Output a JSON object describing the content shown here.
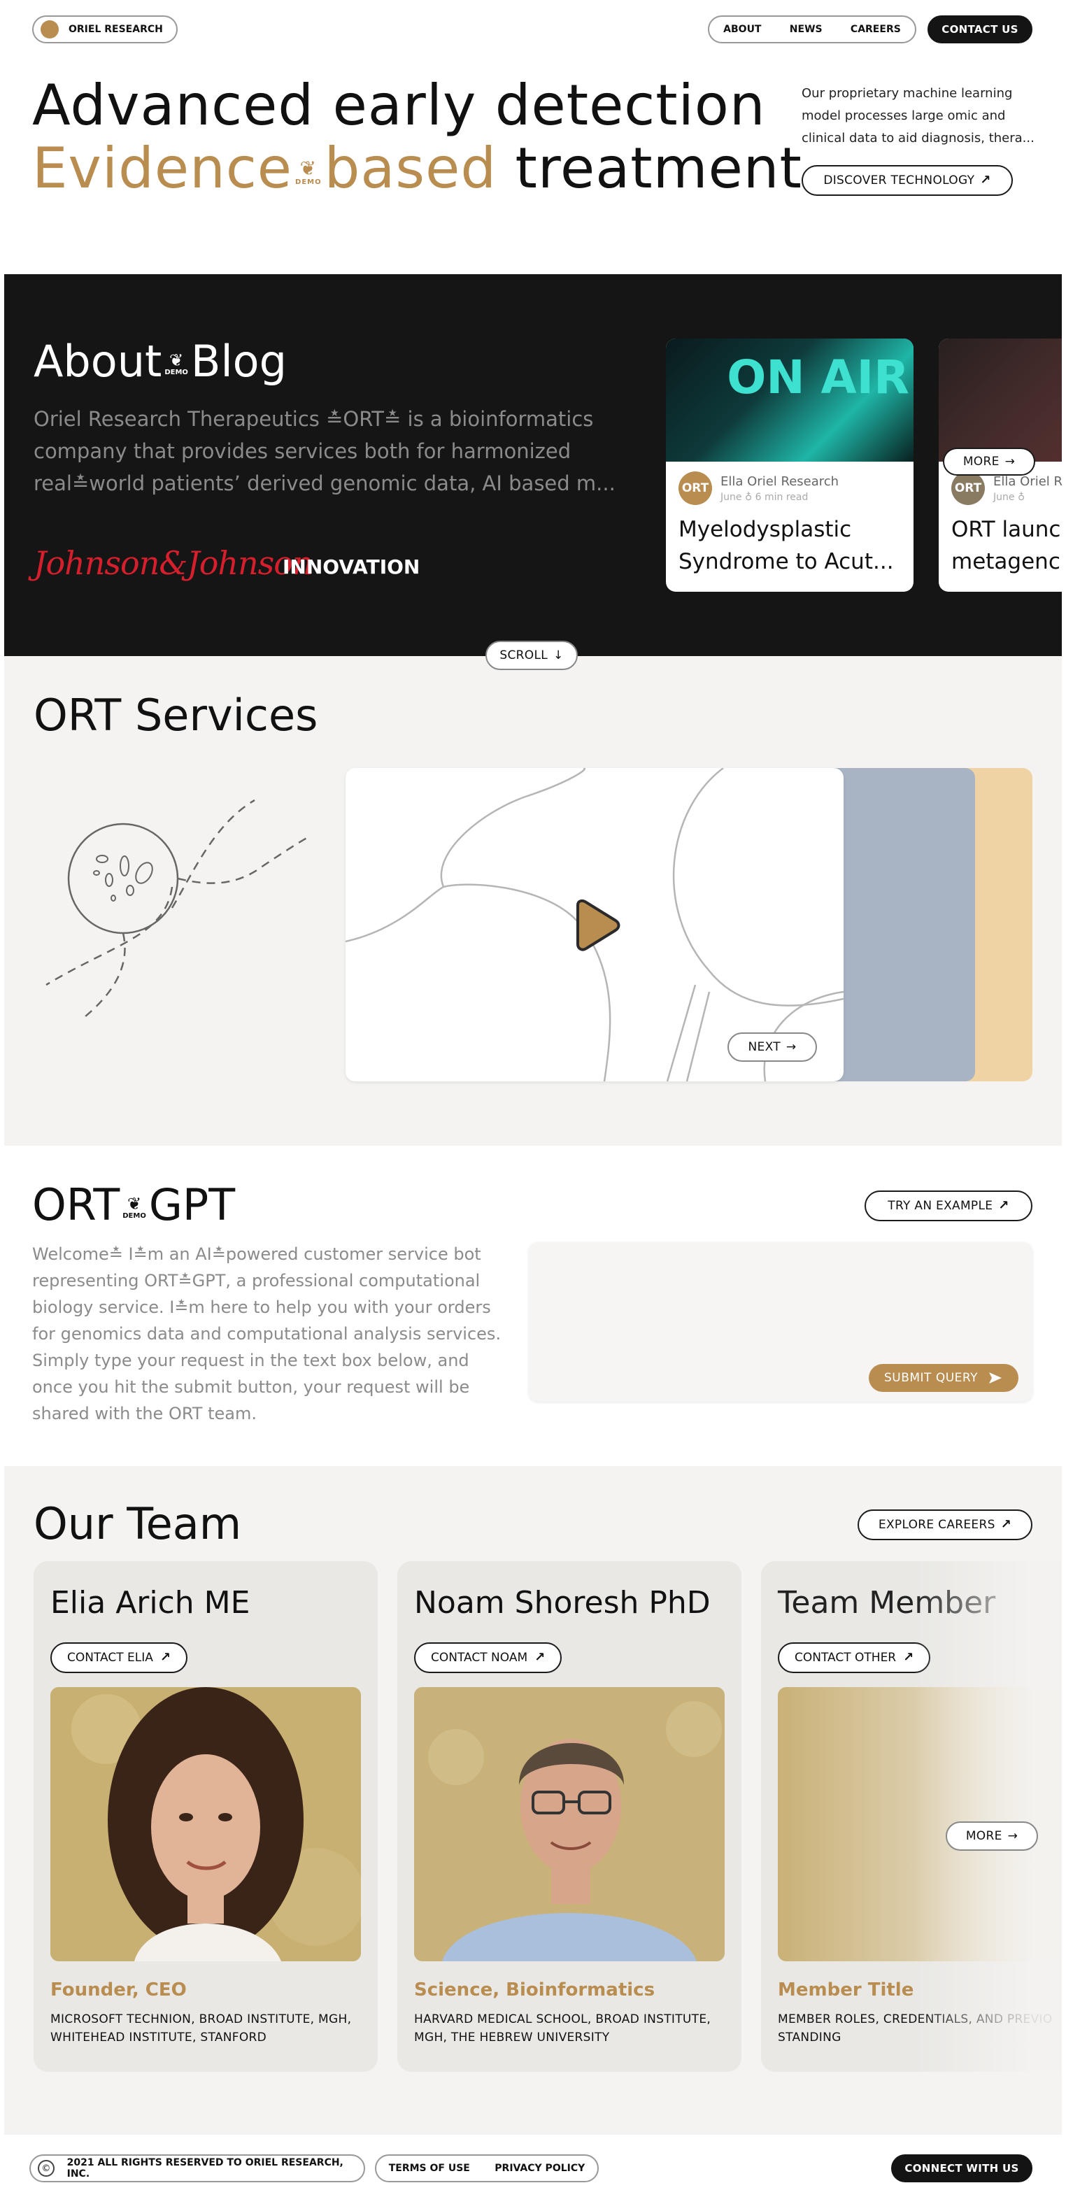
{
  "nav": {
    "brand": "ORIEL RESEARCH",
    "links": [
      "ABOUT",
      "NEWS",
      "CAREERS"
    ],
    "contact": "CONTACT US"
  },
  "hero": {
    "line1": "Advanced early detection",
    "line2_a": "Evidence",
    "line2_b": "based",
    "line2_c": "treatment.",
    "demo_mark": "DEMO",
    "description": "Our proprietary machine learning model processes large omic and clinical data to aid diagnosis, thera...",
    "cta": "DISCOVER TECHNOLOGY"
  },
  "about": {
    "title_a": "About",
    "title_b": "Blog",
    "demo_mark": "DEMO",
    "body": "Oriel Research Therapeutics ≛ORT≛ is a bioinformatics company that provides services both for harmonized real≛world patients’ derived genomic data, AI based m...",
    "partner_logo": "Johnson&Johnson",
    "partner_suffix": "INNOVATION"
  },
  "blog": {
    "cards": [
      {
        "image_text": "ON AIR",
        "avatar": "ORT",
        "author": "Ella Oriel Research",
        "date": "June ♁ 6 min read",
        "title": "Myelodysplastic Syndrome to Acut..."
      },
      {
        "image_text": "",
        "avatar": "ORT",
        "author": "Ella Oriel R",
        "date": "June ♁",
        "title": "ORT launc metagenc"
      }
    ],
    "more": "MORE",
    "scroll": "SCROLL"
  },
  "services": {
    "title": "ORT Services",
    "next": "NEXT"
  },
  "gpt": {
    "title_a": "ORT",
    "title_b": "GPT",
    "demo_mark": "DEMO",
    "try": "TRY AN EXAMPLE",
    "description": "Welcome≛ I≛m an AI≛powered customer service bot representing ORT≛GPT, a professional computational biology service. I≛m here to help you with your orders for genomics data and computational analysis services. Simply type your request in the text box below, and once you hit the submit button, your request will be shared with the ORT team.",
    "submit": "SUBMIT QUERY"
  },
  "team": {
    "title": "Our Team",
    "explore": "EXPLORE CAREERS",
    "more": "MORE",
    "members": [
      {
        "name": "Elia Arich ME",
        "contact": "CONTACT ELIA",
        "role": "Founder, CEO",
        "credentials": "MICROSOFT TECHNION, BROAD INSTITUTE, MGH, WHITEHEAD INSTITUTE, STANFORD"
      },
      {
        "name": "Noam Shoresh PhD",
        "contact": "CONTACT NOAM",
        "role": "Science, Bioinformatics",
        "credentials": "HARVARD MEDICAL SCHOOL, BROAD INSTITUTE, MGH, THE HEBREW UNIVERSITY"
      },
      {
        "name": "Team Member",
        "contact": "CONTACT OTHER",
        "role": "Member Title",
        "credentials": "MEMBER ROLES, CREDENTIALS, AND PREVIO STANDING"
      }
    ]
  },
  "footer": {
    "copyright": "2021 ALL RIGHTS RESERVED TO ORIEL RESEARCH, INC.",
    "terms": "TERMS OF USE",
    "privacy": "PRIVACY POLICY",
    "connect": "CONNECT WITH US"
  },
  "colors": {
    "accent": "#b98c4f",
    "dark": "#151515",
    "section_bg": "#f4f3f1",
    "jj_red": "#d61f2c"
  },
  "icons": [
    "logo-dot-icon",
    "arrow-up-right-icon",
    "arrow-right-icon",
    "arrow-down-icon",
    "play-icon",
    "send-icon",
    "copyright-icon",
    "leaf-demo-icon"
  ]
}
